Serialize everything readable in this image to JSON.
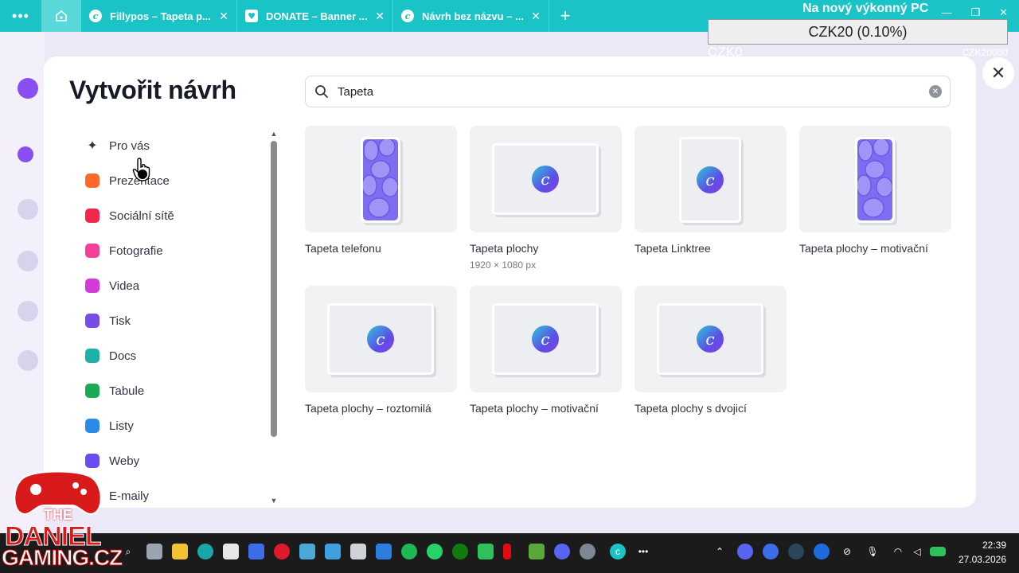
{
  "browser": {
    "menu_icon": "dots-icon",
    "tabs": [
      {
        "title": "Fillypos – Tapeta p...",
        "icon": "canva-icon"
      },
      {
        "title": "DONATE – Banner ...",
        "icon": "heart-icon"
      },
      {
        "title": "Návrh bez názvu – ...",
        "icon": "canva-icon"
      }
    ],
    "close_glyph": "✕",
    "new_tab_glyph": "+"
  },
  "overlay": {
    "title": "Na nový výkonný PC",
    "progress_text": "CZK20 (0.10%)",
    "progress_fraction": 0.001,
    "min_label": "CZK0",
    "max_label": "CZK20000"
  },
  "modal": {
    "title": "Vytvořit návrh",
    "search": {
      "value": "Tapeta",
      "placeholder": ""
    },
    "categories": [
      {
        "label": "Pro vás",
        "color": "#303443",
        "icon": "sparkle-icon"
      },
      {
        "label": "Prezentace",
        "color": "#ff6a2b",
        "icon": "presentation-icon"
      },
      {
        "label": "Sociální sítě",
        "color": "#f2274c",
        "icon": "heart-icon"
      },
      {
        "label": "Fotografie",
        "color": "#f2409b",
        "icon": "camera-icon"
      },
      {
        "label": "Videa",
        "color": "#d43ad8",
        "icon": "video-icon"
      },
      {
        "label": "Tisk",
        "color": "#7a4ce6",
        "icon": "printer-icon"
      },
      {
        "label": "Docs",
        "color": "#1fb0a8",
        "icon": "doc-icon"
      },
      {
        "label": "Tabule",
        "color": "#1aaa55",
        "icon": "whiteboard-icon"
      },
      {
        "label": "Listy",
        "color": "#2b8be6",
        "icon": "sheet-icon"
      },
      {
        "label": "Weby",
        "color": "#6b4cf0",
        "icon": "website-icon"
      },
      {
        "label": "E-maily",
        "color": "#7a4ce6",
        "icon": "email-icon"
      }
    ],
    "results": [
      {
        "label": "Tapeta telefonu",
        "sub": "",
        "thumb": "phone"
      },
      {
        "label": "Tapeta plochy",
        "sub": "1920 × 1080 px",
        "thumb": "desktop"
      },
      {
        "label": "Tapeta Linktree",
        "sub": "",
        "thumb": "tall"
      },
      {
        "label": "Tapeta plochy – motivační",
        "sub": "",
        "thumb": "phone"
      },
      {
        "label": "Tapeta plochy – roztomilá",
        "sub": "",
        "thumb": "desktop"
      },
      {
        "label": "Tapeta plochy – motivační",
        "sub": "",
        "thumb": "desktop"
      },
      {
        "label": "Tapeta plochy s dvojicí",
        "sub": "",
        "thumb": "desktop"
      }
    ],
    "close_glyph": "✕"
  },
  "taskbar": {
    "time": "22:39",
    "date": "27.03.2026"
  },
  "watermark": {
    "line1": "THE",
    "line2": "DANIEL",
    "line3": "GAMING.CZ"
  }
}
